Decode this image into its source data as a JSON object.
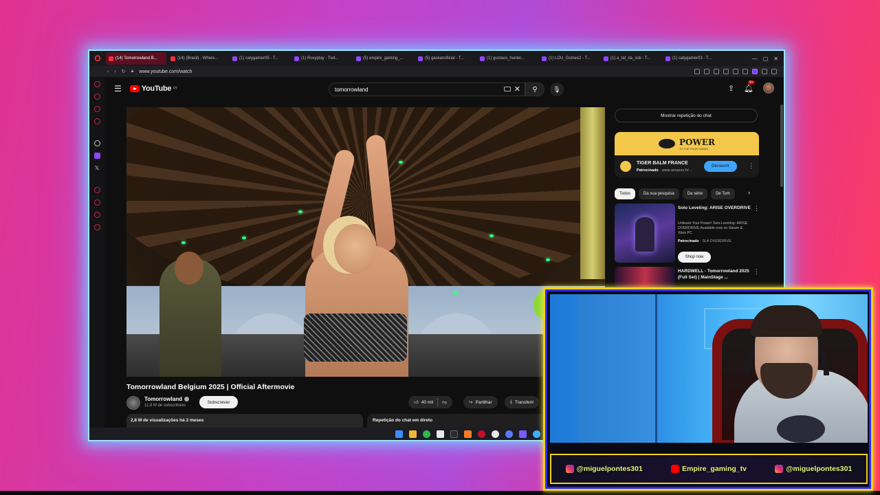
{
  "browser": {
    "tabs": [
      {
        "label": "(14) Tomorrowland B...",
        "color": "#ff2d3d",
        "active": true
      },
      {
        "label": "(14) (Brasil) - Where...",
        "color": "#ff2d3d"
      },
      {
        "label": "(1) catygamer05 - T...",
        "color": "#9146ff"
      },
      {
        "label": "(1) Roxyplay - Twit...",
        "color": "#9146ff"
      },
      {
        "label": "(5) empire_gaming_...",
        "color": "#9146ff"
      },
      {
        "label": "(5) gaskanoficial - T...",
        "color": "#9146ff"
      },
      {
        "label": "(1) gustavo_hunter...",
        "color": "#9146ff"
      },
      {
        "label": "(1) LOU_Gomes2 - T...",
        "color": "#9146ff"
      },
      {
        "label": "(1) a_tal_da_sok - T...",
        "color": "#9146ff"
      },
      {
        "label": "(1) catygamer03 - T...",
        "color": "#9146ff"
      }
    ],
    "url": "www.youtube.com/watch"
  },
  "youtube": {
    "logo_text": "YouTube",
    "logo_sup": "PT",
    "search_value": "tomorrowland",
    "notif_count": "9+",
    "video_title": "Tomorrowland Belgium 2025 | Official Aftermovie",
    "channel_name": "Tomorrowland",
    "channel_subs": "11,9 M de subscritores",
    "subscribe_label": "Subscrever",
    "likes": "40 mil",
    "share_label": "Partilhar",
    "download_label": "Transferir",
    "views_meta": "2,8 M de visualizações  há 2 meses",
    "chat_replay_label": "Repetição do chat em direto",
    "show_chat_label": "Mostrar repetição do chat",
    "ad": {
      "banner_text": "POWER",
      "banner_tag": "TO THE YOUR HANDS",
      "name": "TIGER BALM FRANCE",
      "sponsored": "Patrocinado",
      "domain": "· www.amazon.fr/...",
      "cta": "Découvrir"
    },
    "chips": [
      "Todos",
      "Da sua pesquisa",
      "Da série",
      "De Tom"
    ],
    "recommendations": [
      {
        "title": "Solo Leveling: ARISE OVERDRIVE",
        "desc": "Unleash Your Power! Solo Leveling: ARISE OVERDRIVE Available now on Steam & Xbox PC",
        "sponsored": "Patrocinado",
        "sponsor": " · SLA OVERDRIVE",
        "cta": "Shop now"
      },
      {
        "title": "HARDWELL - Tomorrowland 2025 (Full Set) | MainStage ..."
      }
    ]
  },
  "overlay": {
    "socials": [
      {
        "icon": "instagram-icon",
        "handle": "@miguelpontes301"
      },
      {
        "icon": "youtube-icon",
        "handle": "Empire_gaming_tv"
      },
      {
        "icon": "instagram-icon",
        "handle": "@miguelpontes301"
      }
    ]
  }
}
